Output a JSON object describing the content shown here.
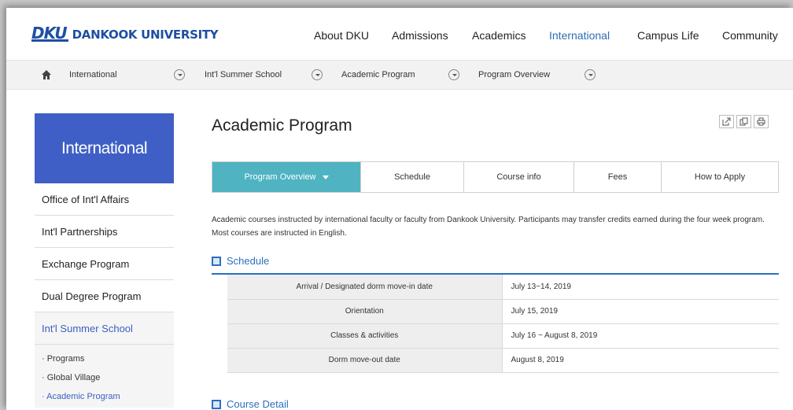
{
  "header": {
    "logo_mark": "DKU",
    "logo_text": "DANKOOK UNIVERSITY",
    "nav": [
      {
        "label": "About DKU",
        "active": false
      },
      {
        "label": "Admissions",
        "active": false
      },
      {
        "label": "Academics",
        "active": false
      },
      {
        "label": "International",
        "active": true
      },
      {
        "label": "Campus Life",
        "active": false
      },
      {
        "label": "Community",
        "active": false
      }
    ]
  },
  "breadcrumb": {
    "home_icon": "home-icon",
    "items": [
      "International",
      "Int'l Summer School",
      "Academic Program",
      "Program Overview"
    ]
  },
  "sidebar": {
    "title": "International",
    "items": [
      {
        "label": "Office of Int'l Affairs",
        "active": false
      },
      {
        "label": "Int'l Partnerships",
        "active": false
      },
      {
        "label": "Exchange Program",
        "active": false
      },
      {
        "label": "Dual Degree Program",
        "active": false
      },
      {
        "label": "Int'l Summer School",
        "active": true
      }
    ],
    "sub_items": [
      {
        "label": "· Programs",
        "active": false
      },
      {
        "label": "· Global Village",
        "active": false
      },
      {
        "label": "· Academic Program",
        "active": true
      }
    ]
  },
  "main": {
    "title": "Academic Program",
    "util_icons": [
      "share-icon",
      "copy-icon",
      "print-icon"
    ],
    "tabs": [
      {
        "label": "Program Overview",
        "active": true
      },
      {
        "label": "Schedule",
        "active": false
      },
      {
        "label": "Course info",
        "active": false
      },
      {
        "label": "Fees",
        "active": false
      },
      {
        "label": "How to Apply",
        "active": false
      }
    ],
    "intro": "Academic courses instructed by international faculty or faculty from Dankook University. Participants may transfer credits earned during the four week program. Most courses are instructed in English.",
    "schedule_heading": "Schedule",
    "schedule": [
      {
        "label": "Arrival / Designated dorm move-in date",
        "value": "July 13~14, 2019"
      },
      {
        "label": "Orientation",
        "value": "July 15, 2019"
      },
      {
        "label": "Classes & activities",
        "value": "July 16 ~ August 8, 2019"
      },
      {
        "label": "Dorm move-out date",
        "value": "August 8, 2019"
      }
    ],
    "course_heading": "Course Detail"
  },
  "colors": {
    "brand": "#1e4fa3",
    "sidebar_title_bg": "#3f5fc6",
    "active_tab_bg": "#4fb3c1",
    "section_accent": "#2c6fbf"
  }
}
